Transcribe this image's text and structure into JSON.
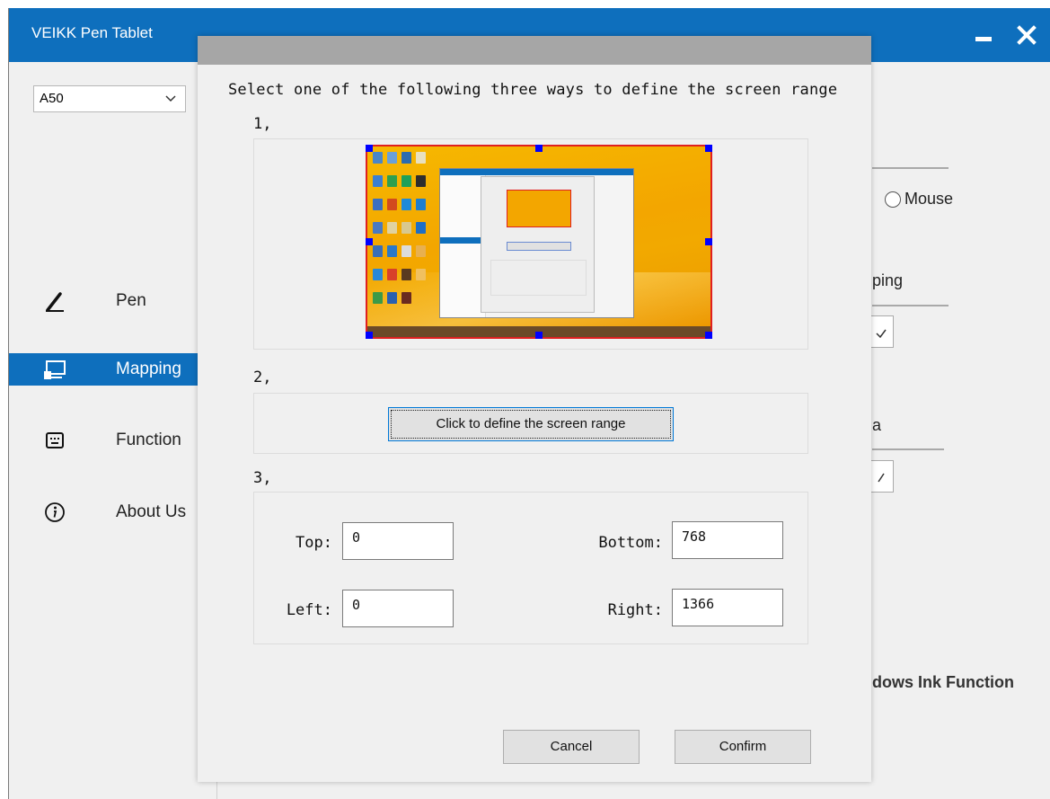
{
  "app": {
    "title": "VEIKK Pen Tablet",
    "accent_color": "#0e6fbd"
  },
  "device_select": {
    "selected": "A50"
  },
  "sidebar": {
    "items": [
      {
        "label": "Pen",
        "icon": "pen-icon",
        "active": false
      },
      {
        "label": "Mapping",
        "icon": "monitor-icon",
        "active": true
      },
      {
        "label": "Function",
        "icon": "keyboard-icon",
        "active": false
      },
      {
        "label": "About Us",
        "icon": "info-icon",
        "active": false
      }
    ]
  },
  "background_panel": {
    "mode_option": "Mouse",
    "section_mapping_fragment": "ping",
    "section_area_fragment": "a",
    "windows_ink_fragment": "dows Ink Function"
  },
  "dialog": {
    "heading": "Select one of the following three ways to define the screen range",
    "step1_label": "1,",
    "step2_label": "2,",
    "step3_label": "3,",
    "define_button": "Click to define the screen range",
    "fields": {
      "top_label": "Top:",
      "top_value": "0",
      "left_label": "Left:",
      "left_value": "0",
      "bottom_label": "Bottom:",
      "bottom_value": "768",
      "right_label": "Right:",
      "right_value": "1366"
    },
    "cancel_button": "Cancel",
    "confirm_button": "Confirm"
  }
}
